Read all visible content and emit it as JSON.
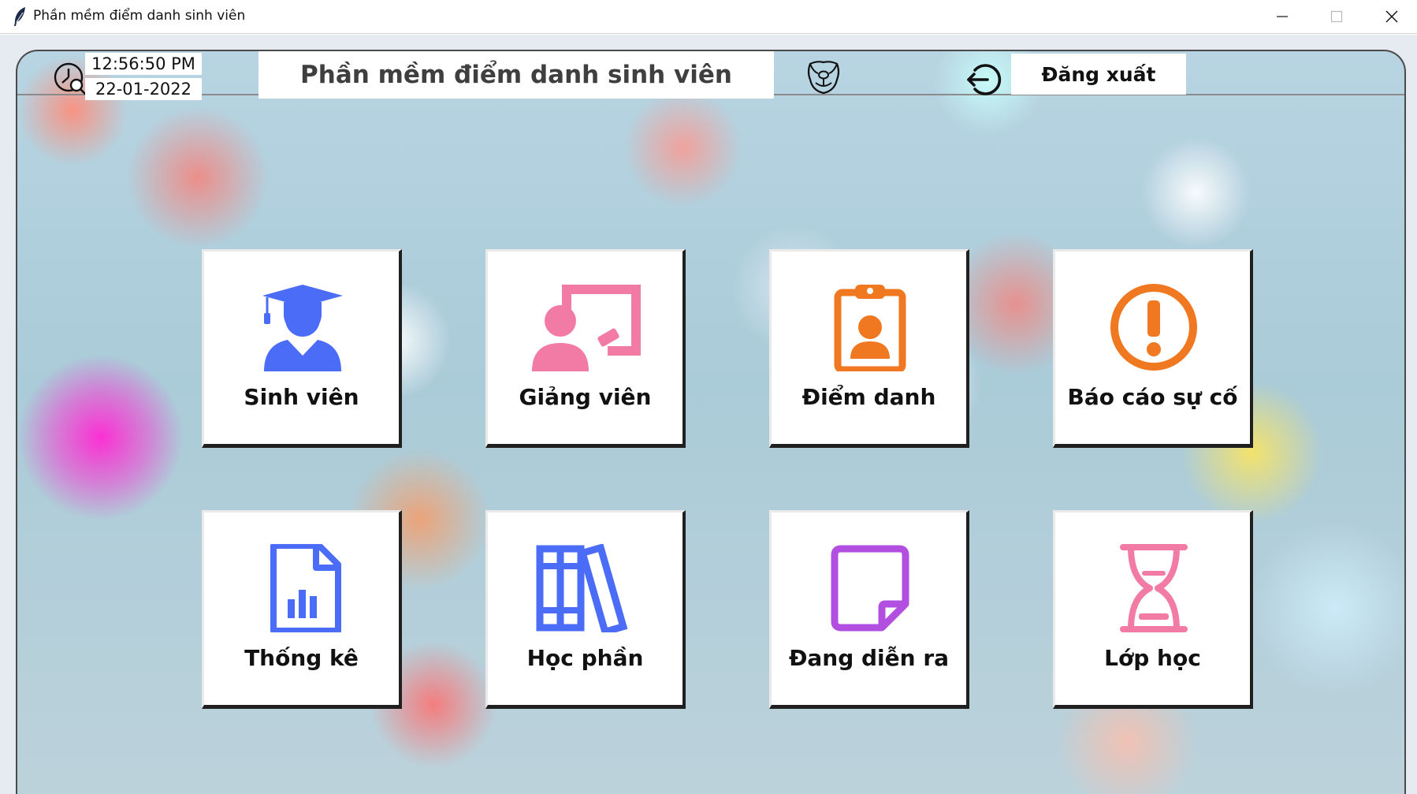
{
  "window": {
    "title": "Phần mềm điểm danh sinh viên",
    "controls": [
      "minimize",
      "maximize",
      "close"
    ]
  },
  "header": {
    "time": "12:56:50 PM",
    "date": "22-01-2022",
    "app_title": "Phần mềm điểm danh sinh viên",
    "logout_label": "Đăng xuất",
    "icons": [
      "clock-search-icon",
      "pig-mask-icon",
      "logout-arrow-icon"
    ]
  },
  "tiles": [
    {
      "label": "Sinh viên",
      "icon": "student-icon",
      "color": "#4a6cf7"
    },
    {
      "label": "Giảng viên",
      "icon": "teacher-icon",
      "color": "#f27ba5"
    },
    {
      "label": "Điểm danh",
      "icon": "clipboard-id-icon",
      "color": "#f07820"
    },
    {
      "label": "Báo cáo sự cố",
      "icon": "alert-icon",
      "color": "#f07820"
    },
    {
      "label": "Thống kê",
      "icon": "report-chart-icon",
      "color": "#4a6cf7"
    },
    {
      "label": "Học phần",
      "icon": "books-icon",
      "color": "#4a6cf7"
    },
    {
      "label": "Đang diễn ra",
      "icon": "sticky-note-icon",
      "color": "#b24fe0"
    },
    {
      "label": "Lớp học",
      "icon": "hourglass-icon",
      "color": "#f27ba5"
    }
  ]
}
